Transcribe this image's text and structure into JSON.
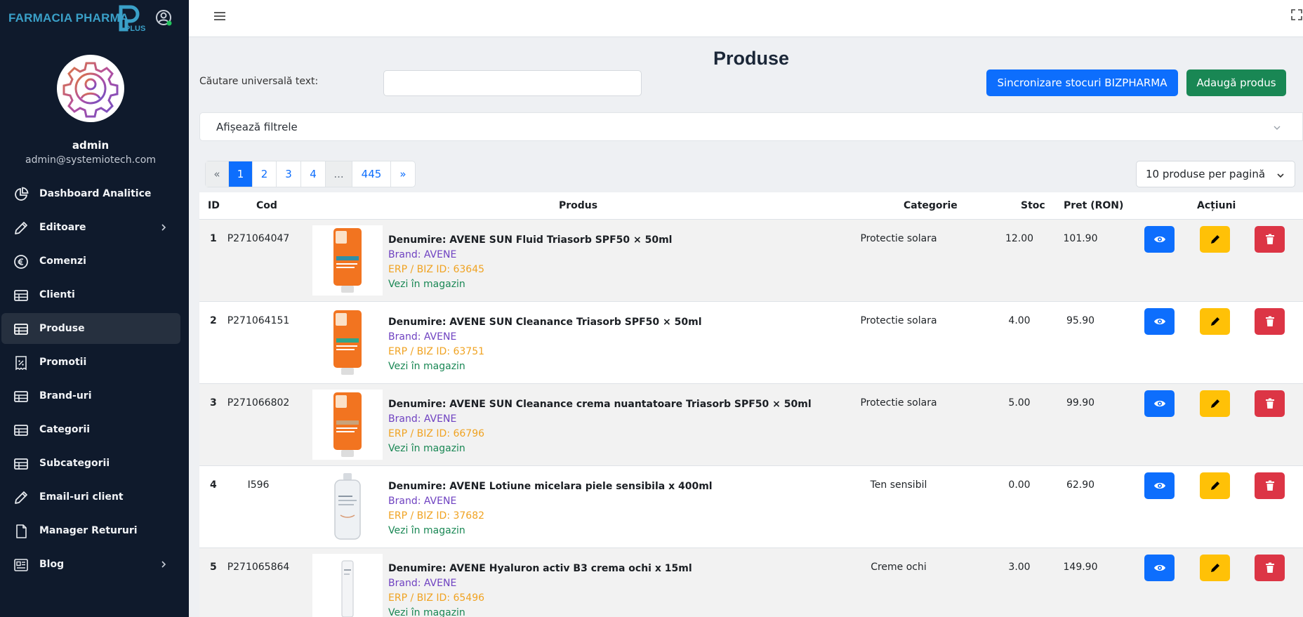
{
  "app": {
    "brand": "FARMACIA PHARMA",
    "logo_letters": "PLUS"
  },
  "user": {
    "name": "admin",
    "email": "admin@systemiotech.com"
  },
  "sidebar": {
    "items": [
      {
        "label": "Dashboard Analitice",
        "icon": "pie-chart-icon"
      },
      {
        "label": "Editoare",
        "icon": "pencil-icon",
        "has_submenu": true
      },
      {
        "label": "Comenzi",
        "icon": "euro-circle-icon"
      },
      {
        "label": "Clienti",
        "icon": "table-icon"
      },
      {
        "label": "Produse",
        "icon": "table-icon",
        "active": true
      },
      {
        "label": "Promotii",
        "icon": "discount-receipt-icon"
      },
      {
        "label": "Brand-uri",
        "icon": "table-icon"
      },
      {
        "label": "Categorii",
        "icon": "table-icon"
      },
      {
        "label": "Subcategorii",
        "icon": "table-icon"
      },
      {
        "label": "Email-uri client",
        "icon": "pencil-icon"
      },
      {
        "label": "Manager Retururi",
        "icon": "document-icon"
      },
      {
        "label": "Blog",
        "icon": "blog-icon",
        "has_submenu": true
      }
    ]
  },
  "main": {
    "title": "Produse",
    "search": {
      "label": "Căutare universală text:",
      "value": "",
      "placeholder": ""
    },
    "buttons": {
      "sync": "Sincronizare stocuri BIZPHARMA",
      "add": "Adaugă produs"
    },
    "filters_label": "Afișează filtrele",
    "pagination": {
      "prev": "«",
      "pages": [
        "1",
        "2",
        "3",
        "4"
      ],
      "ellipsis": "...",
      "last": "445",
      "next": "»",
      "current": "1"
    },
    "per_page": "10 produse per pagină"
  },
  "table": {
    "headers": {
      "id": "ID",
      "code": "Cod",
      "product": "Produs",
      "category": "Categorie",
      "stock": "Stoc",
      "price": "Pret (RON)",
      "actions": "Acțiuni"
    },
    "rows": [
      {
        "id": "1",
        "code": "P271064047",
        "name": "Denumire: AVENE SUN Fluid Triasorb SPF50 × 50ml",
        "brand": "Brand: AVENE",
        "erp": "ERP / BIZ ID: 63645",
        "link": "Vezi în magazin",
        "category": "Protectie solara",
        "stock": "12.00",
        "price": "101.90"
      },
      {
        "id": "2",
        "code": "P271064151",
        "name": "Denumire: AVENE SUN Cleanance Triasorb SPF50 × 50ml",
        "brand": "Brand: AVENE",
        "erp": "ERP / BIZ ID: 63751",
        "link": "Vezi în magazin",
        "category": "Protectie solara",
        "stock": "4.00",
        "price": "95.90"
      },
      {
        "id": "3",
        "code": "P271066802",
        "name": "Denumire: AVENE SUN Cleanance crema nuantatoare Triasorb SPF50 × 50ml",
        "brand": "Brand: AVENE",
        "erp": "ERP / BIZ ID: 66796",
        "link": "Vezi în magazin",
        "category": "Protectie solara",
        "stock": "5.00",
        "price": "99.90"
      },
      {
        "id": "4",
        "code": "I596",
        "name": "Denumire: AVENE Lotiune micelara piele sensibila x 400ml",
        "brand": "Brand: AVENE",
        "erp": "ERP / BIZ ID: 37682",
        "link": "Vezi în magazin",
        "category": "Ten sensibil",
        "stock": "0.00",
        "price": "62.90"
      },
      {
        "id": "5",
        "code": "P271065864",
        "name": "Denumire: AVENE Hyaluron activ B3 crema ochi x 15ml",
        "brand": "Brand: AVENE",
        "erp": "ERP / BIZ ID: 65496",
        "link": "Vezi în magazin",
        "category": "Creme ochi",
        "stock": "3.00",
        "price": "149.90"
      }
    ]
  },
  "colors": {
    "sidebar_bg": "#0f1a2c",
    "primary": "#0d6efd",
    "success": "#198754",
    "warning": "#ffc107",
    "danger": "#dc3545",
    "brand_text": "#3aa0c8"
  }
}
